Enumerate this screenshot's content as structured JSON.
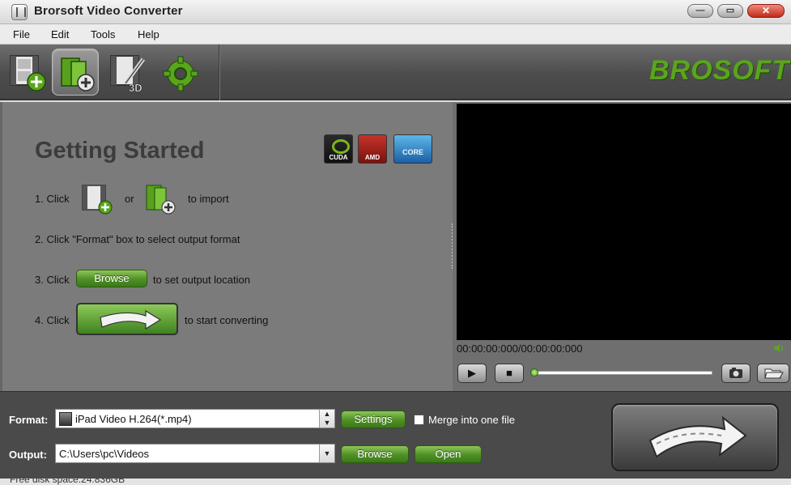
{
  "window": {
    "title": "Brorsoft Video Converter",
    "minimize_glyph": "—",
    "maximize_glyph": "▭",
    "close_glyph": "✕"
  },
  "menu": [
    "File",
    "Edit",
    "Tools",
    "Help"
  ],
  "toolbar": {
    "items": [
      {
        "name": "add-video-icon",
        "selected": false
      },
      {
        "name": "load-files-icon",
        "selected": true
      },
      {
        "name": "edit-3d-icon",
        "selected": false,
        "badge": "3D"
      },
      {
        "name": "settings-gear-icon",
        "selected": false
      }
    ],
    "logo_text": "BROSOFT"
  },
  "getting_started": {
    "title": "Getting Started",
    "badges": [
      "CUDA",
      "AMD",
      "CORE"
    ],
    "step1_prefix": "1. Click",
    "step1_or": "or",
    "step1_suffix": "to import",
    "step2": "2. Click \"Format\" box to select output format",
    "step3_prefix": "3. Click",
    "step3_button": "Browse",
    "step3_suffix": "to set output location",
    "step4_prefix": "4. Click",
    "step4_suffix": "to start converting"
  },
  "player": {
    "timecode": "00:00:00:000/00:00:00:000",
    "progress": 0,
    "controls": [
      "play-icon",
      "stop-icon",
      "snapshot-icon",
      "open-folder-icon"
    ]
  },
  "output": {
    "format_label": "Format:",
    "format_value": "iPad Video H.264(*.mp4)",
    "settings_button": "Settings",
    "merge_label": "Merge into one file",
    "merge_checked": false,
    "output_label": "Output:",
    "output_value": "C:\\Users\\pc\\Videos",
    "browse_button": "Browse",
    "open_button": "Open"
  },
  "status": {
    "free_disk": "Free disk space:24.836GB"
  },
  "colors": {
    "accent_green": "#4f8f26",
    "panel_gray": "#7b7b7b",
    "video_black": "#000000"
  }
}
